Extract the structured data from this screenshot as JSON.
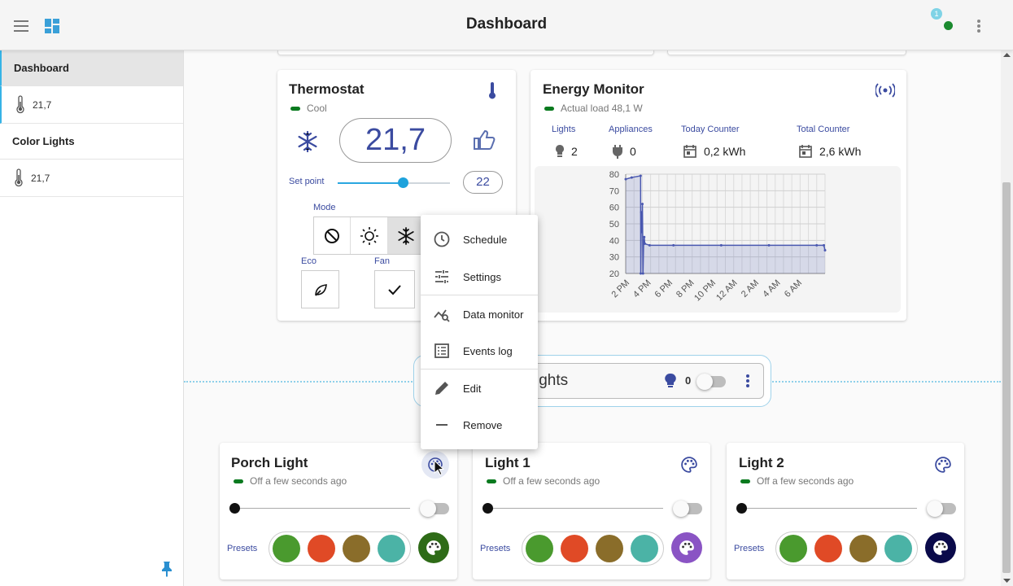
{
  "header": {
    "title": "Dashboard",
    "notification_count": "1"
  },
  "sidebar": {
    "sections": [
      {
        "title": "Dashboard",
        "items": [
          {
            "label": "21,7",
            "icon": "thermometer-icon"
          }
        ]
      },
      {
        "title": "Color Lights",
        "items": [
          {
            "label": "21,7",
            "icon": "thermometer-icon"
          }
        ]
      }
    ]
  },
  "thermostat": {
    "title": "Thermostat",
    "status": "Cool",
    "temperature": "21,7",
    "setpoint_label": "Set point",
    "setpoint_value": "22",
    "setpoint_fraction": 0.58,
    "mode_label": "Mode",
    "modes": [
      "off",
      "heat",
      "cool"
    ],
    "selected_mode": "cool",
    "eco_label": "Eco",
    "fan_label": "Fan"
  },
  "energy": {
    "title": "Energy Monitor",
    "status": "Actual load 48,1 W",
    "stats": [
      {
        "label": "Lights",
        "value": "2"
      },
      {
        "label": "Appliances",
        "value": "0"
      },
      {
        "label": "Today Counter",
        "value": "0,2 kWh"
      },
      {
        "label": "Total Counter",
        "value": "2,6 kWh"
      }
    ]
  },
  "chart_data": {
    "type": "area",
    "title": "",
    "xlabel": "",
    "ylabel": "",
    "ylim": [
      20,
      80
    ],
    "y_ticks": [
      "20",
      "30",
      "40",
      "50",
      "60",
      "70",
      "80"
    ],
    "x_ticks": [
      "2 PM",
      "4 PM",
      "6 PM",
      "8 PM",
      "10 PM",
      "12 AM",
      "2 AM",
      "4 AM",
      "6 AM"
    ],
    "grid": true,
    "series": [
      {
        "x": [
          0,
          0.5,
          1.25,
          1.26,
          1.3,
          1.35,
          1.4,
          1.45,
          1.5,
          1.55,
          1.6,
          2.0,
          4.0,
          8.0,
          12.0,
          16.0,
          16.6,
          16.7
        ],
        "y": [
          77,
          78,
          79,
          20,
          57,
          45,
          62,
          20,
          38,
          42,
          38,
          37,
          37,
          37,
          37,
          37,
          37,
          34
        ]
      }
    ]
  },
  "group": {
    "title": "Color Lights",
    "visible_title": "ights",
    "count": "0"
  },
  "lights": [
    {
      "title": "Porch Light",
      "status": "Off a few seconds ago",
      "presets_label": "Presets",
      "palette_color": "#2e6b17"
    },
    {
      "title": "Light 1",
      "status": "Off a few seconds ago",
      "presets_label": "Presets",
      "palette_color": "#8a54c4"
    },
    {
      "title": "Light 2",
      "status": "Off a few seconds ago",
      "presets_label": "Presets",
      "palette_color": "#0a0a4a"
    }
  ],
  "preset_colors": [
    "#4a9a2e",
    "#e04a26",
    "#8a6d2a",
    "#4bb3a6"
  ],
  "context_menu": {
    "items": [
      {
        "label": "Schedule",
        "icon": "clock-icon"
      },
      {
        "label": "Settings",
        "icon": "sliders-icon"
      },
      {
        "label": "Data monitor",
        "icon": "chart-search-icon"
      },
      {
        "label": "Events log",
        "icon": "list-icon"
      },
      {
        "label": "Edit",
        "icon": "pencil-icon"
      },
      {
        "label": "Remove",
        "icon": "minus-icon"
      }
    ]
  },
  "colors": {
    "accent": "#3b4ba0",
    "status_ok": "#0a7a1f",
    "highlight": "#36b3e6"
  }
}
